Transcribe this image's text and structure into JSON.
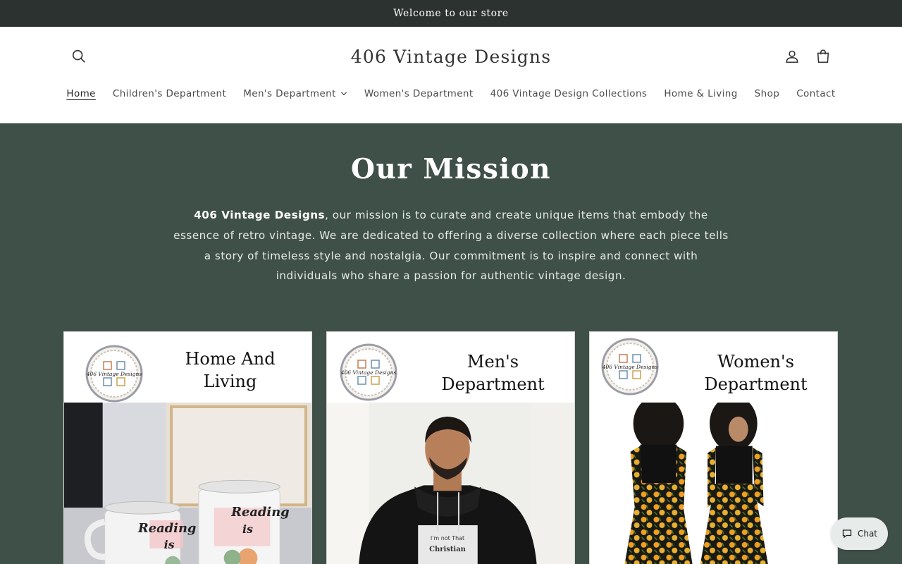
{
  "announcement": {
    "text": "Welcome to our store"
  },
  "header": {
    "brand": "406 Vintage Designs",
    "icons": {
      "search": "search-icon",
      "account": "account-icon",
      "cart": "cart-icon"
    }
  },
  "nav": {
    "items": [
      {
        "label": "Home",
        "active": true
      },
      {
        "label": "Children's Department"
      },
      {
        "label": "Men's Department",
        "has_dropdown": true
      },
      {
        "label": "Women's Department"
      },
      {
        "label": "406 Vintage Design Collections"
      },
      {
        "label": "Home & Living"
      },
      {
        "label": "Shop"
      },
      {
        "label": "Contact"
      }
    ]
  },
  "mission": {
    "title": "Our Mission",
    "brand_bold": "406 Vintage Designs",
    "text": ", our mission is to curate and create unique items that embody the essence of retro vintage. We are dedicated to offering a diverse collection where each piece tells a story of timeless style and nostalgia. Our commitment is to inspire and connect with individuals who share a passion for authentic vintage design."
  },
  "cards": [
    {
      "title": "Home And Living",
      "logo_text": "406 Vintage Designs",
      "mug_text_1": "Reading",
      "mug_text_2": "is"
    },
    {
      "title": "Men's Department",
      "logo_text": "406 Vintage Designs",
      "shirt_text_1": "I'm not That",
      "shirt_text_2": "Christian"
    },
    {
      "title": "Women's Department",
      "logo_text": "406 Vintage Designs"
    }
  ],
  "chat": {
    "label": "Chat"
  },
  "colors": {
    "announcement_bg": "#2c322f",
    "mission_bg": "#3f5048",
    "chat_bg": "#e7ebe9"
  }
}
